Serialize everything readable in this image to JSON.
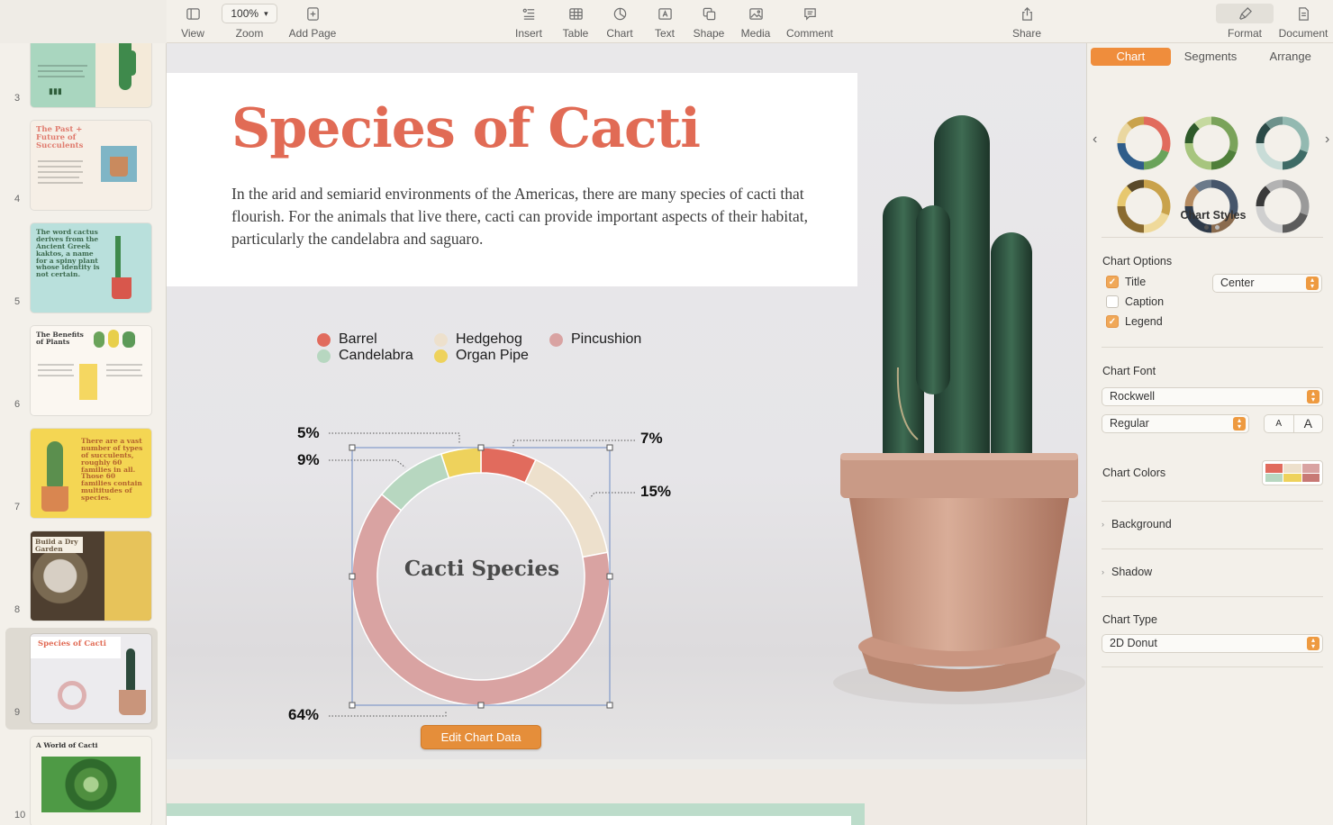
{
  "toolbar": {
    "view": "View",
    "zoom_value": "100%",
    "zoom": "Zoom",
    "add_page": "Add Page",
    "insert": "Insert",
    "table": "Table",
    "chart": "Chart",
    "text": "Text",
    "shape": "Shape",
    "media": "Media",
    "comment": "Comment",
    "share": "Share",
    "format": "Format",
    "document": "Document"
  },
  "sidebar": {
    "pages": [
      {
        "num": "3",
        "title": ""
      },
      {
        "num": "4",
        "title": "The Past + Future of Succulents"
      },
      {
        "num": "5",
        "title": "The word cactus derives from the Ancient Greek kaktos, a name for a spiny plant whose identity is not certain."
      },
      {
        "num": "6",
        "title": "The Benefits of Plants"
      },
      {
        "num": "7",
        "title": "There are a vast number of types of succulents, roughly 60 families in all. Those 60 families contain multitudes of species."
      },
      {
        "num": "8",
        "title": "Build a Dry Garden"
      },
      {
        "num": "9",
        "title": "Species of Cacti"
      },
      {
        "num": "10",
        "title": "A World of Cacti"
      }
    ]
  },
  "slide": {
    "title": "Species of Cacti",
    "body": "In the arid and semiarid environments of the Americas, there are many species of cacti that flourish. For the animals that live there, cacti can provide important aspects of their habitat, particularly the candelabra and saguaro."
  },
  "chart_data": {
    "type": "pie",
    "subtype": "2D Donut",
    "title": "Cacti Species",
    "legend_position": "top",
    "series": [
      {
        "name": "Barrel",
        "value": 7,
        "label": "7%",
        "color": "#e16b5d"
      },
      {
        "name": "Hedgehog",
        "value": 15,
        "label": "15%",
        "color": "#ede0cc"
      },
      {
        "name": "Pincushion",
        "value": 64,
        "label": "64%",
        "color": "#d9a3a2"
      },
      {
        "name": "Candelabra",
        "value": 9,
        "label": "9%",
        "color": "#b7d7c0"
      },
      {
        "name": "Organ Pipe",
        "value": 5,
        "label": "5%",
        "color": "#eed25c"
      }
    ]
  },
  "edit_chart_data": "Edit Chart Data",
  "inspector": {
    "tabs": [
      "Chart",
      "Segments",
      "Arrange"
    ],
    "active_tab": "Chart",
    "chart_styles_label": "Chart Styles",
    "chart_options_label": "Chart Options",
    "options": [
      {
        "label": "Title",
        "checked": true
      },
      {
        "label": "Caption",
        "checked": false
      },
      {
        "label": "Legend",
        "checked": true
      }
    ],
    "title_position": "Center",
    "chart_font_label": "Chart Font",
    "font_name": "Rockwell",
    "font_style": "Regular",
    "font_smaller": "A",
    "font_larger": "A",
    "chart_colors_label": "Chart Colors",
    "background_label": "Background",
    "shadow_label": "Shadow",
    "chart_type_label": "Chart Type",
    "chart_type_value": "2D Donut"
  },
  "colors": {
    "accent": "#ef8d3c",
    "title_red": "#e16b55"
  }
}
